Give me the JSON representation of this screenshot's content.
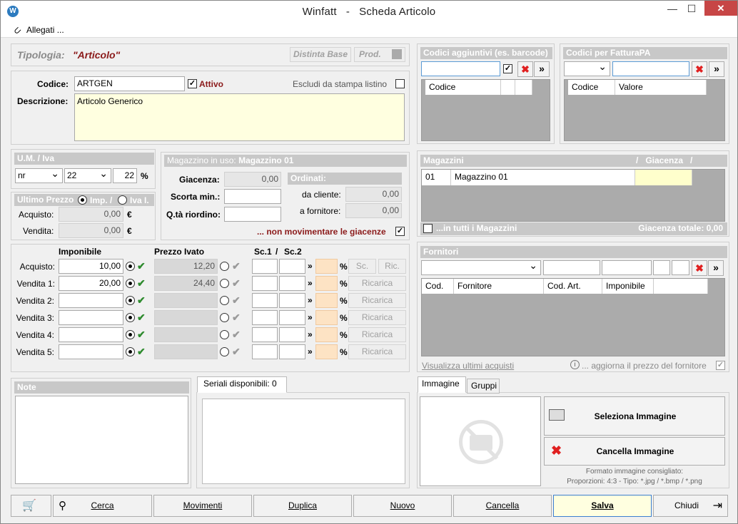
{
  "window": {
    "title": "Winfatt   -   Scheda Articolo",
    "minimize": "—",
    "maximize": "☐",
    "close": "✕",
    "logo": "W"
  },
  "menu": {
    "allegati": "Allegati ..."
  },
  "tipologia": {
    "label": "Tipologia:",
    "value": "\"Articolo\"",
    "distinta_base": "Distinta Base",
    "prod": "Prod."
  },
  "articolo": {
    "codice_label": "Codice:",
    "codice": "ARTGEN",
    "attivo_label": "Attivo",
    "escludi_label": "Escludi da stampa listino",
    "descrizione_label": "Descrizione:",
    "descrizione": "Articolo Generico"
  },
  "um_iva": {
    "header": "U.M. / Iva",
    "um": "nr",
    "iva": "22",
    "iva_value": "22",
    "percent": "%"
  },
  "ultimo_prezzo": {
    "header": "Ultimo Prezzo",
    "imp": "Imp. /",
    "iva_l": "Iva I.",
    "acquisto_label": "Acquisto:",
    "acquisto": "0,00",
    "vendita_label": "Vendita:",
    "vendita": "0,00",
    "euro": "€"
  },
  "magazzino_uso": {
    "header_prefix": "Magazzino in uso:",
    "header_name": "Magazzino 01",
    "giacenza_label": "Giacenza:",
    "giacenza": "0,00",
    "scorta_label": "Scorta min.:",
    "qta_label": "Q.tà riordino:",
    "ordinati_header": "Ordinati:",
    "da_cliente_label": "da cliente:",
    "da_cliente": "0,00",
    "a_fornitore_label": "a fornitore:",
    "a_fornitore": "0,00",
    "non_movimentare": "... non movimentare le giacenze"
  },
  "prezzi": {
    "imponibile_header": "Imponibile",
    "ivato_header": "Prezzo Ivato",
    "sc1_header": "Sc.1",
    "sc2_header": "Sc.2",
    "sc_btn": "Sc.",
    "ric_btn": "Ric.",
    "ricarica": "Ricarica",
    "rows": [
      {
        "label": "Acquisto:",
        "imponibile": "10,00",
        "ivato": "12,20"
      },
      {
        "label": "Vendita 1:",
        "imponibile": "20,00",
        "ivato": "24,40"
      },
      {
        "label": "Vendita 2:",
        "imponibile": "",
        "ivato": ""
      },
      {
        "label": "Vendita 3:",
        "imponibile": "",
        "ivato": ""
      },
      {
        "label": "Vendita 4:",
        "imponibile": "",
        "ivato": ""
      },
      {
        "label": "Vendita 5:",
        "imponibile": "",
        "ivato": ""
      }
    ]
  },
  "codici_aggiuntivi": {
    "header": "Codici aggiuntivi (es. barcode)",
    "col": "Codice"
  },
  "codici_fatturapa": {
    "header": "Codici per FatturaPA",
    "col_codice": "Codice",
    "col_valore": "Valore"
  },
  "magazzini": {
    "header": "Magazzini",
    "giacenza_header": "/   Giacenza   /",
    "row_code": "01",
    "row_name": "Magazzino 01",
    "tutti_label": "...in tutti i Magazzini",
    "giacenza_totale": "Giacenza totale: 0,00"
  },
  "fornitori": {
    "header": "Fornitori",
    "col_cod": "Cod.",
    "col_fornitore": "Fornitore",
    "col_codart": "Cod. Art.",
    "col_imponibile": "Imponibile",
    "ultimi_acquisti": "Visualizza ultimi acquisti",
    "aggiorna": "... aggiorna il prezzo del fornitore"
  },
  "note": {
    "header": "Note"
  },
  "seriali": {
    "tab": "Seriali disponibili: 0"
  },
  "immagine": {
    "tab_immagine": "Immagine",
    "tab_gruppi": "Gruppi",
    "seleziona": "Seleziona Immagine",
    "cancella": "Cancella Immagine",
    "hint1": "Formato immagine consigliato:",
    "hint2": "Proporzioni: 4:3 - Tipo: *.jpg / *.bmp / *.png"
  },
  "bottom": {
    "cerca": "Cerca",
    "movimenti": "Movimenti",
    "duplica": "Duplica",
    "nuovo": "Nuovo",
    "cancella": "Cancella",
    "salva": "Salva",
    "chiudi": "Chiudi"
  },
  "colors": {
    "tipologia_red": "#8b1a1a",
    "header_gray": "#c8c8c8",
    "check_green": "#2e8b2e",
    "salva_bg": "#ffffe0"
  }
}
